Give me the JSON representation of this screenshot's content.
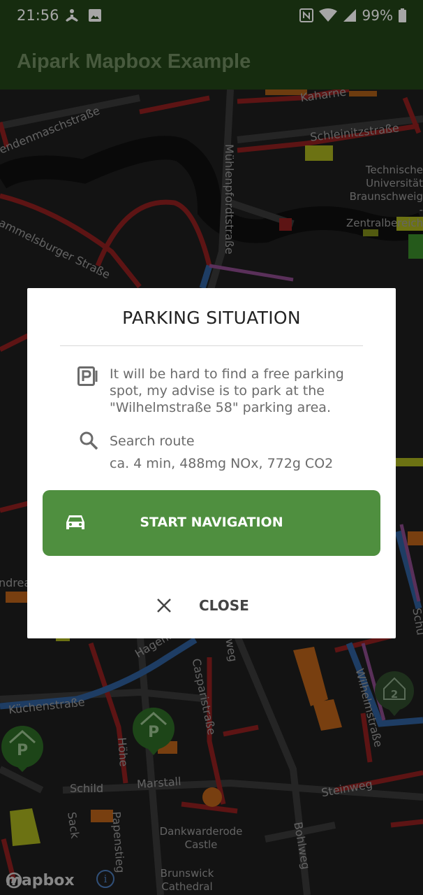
{
  "status_bar": {
    "time": "21:56",
    "battery": "99%",
    "icons": [
      "yoga-icon",
      "image-icon",
      "nfc-icon",
      "wifi-icon",
      "signal-icon",
      "battery-icon"
    ]
  },
  "app_bar": {
    "title": "Aipark Mapbox Example",
    "background": "#224418"
  },
  "map": {
    "labels": {
      "kahlrn": "Kaharne",
      "schleinitz": "Schleinitzstraße",
      "tu": "Technische Universität Braunschweig - Zentralbereich",
      "muehlenpford": "Mühlenpfordtstraße",
      "bammelsburger": "Bammelsburger Straße",
      "endenmasch": "endenmaschstraße",
      "andrea": "ndrea",
      "hagenbr": "Hagenbr",
      "kuechenstr": "Küchenstraße",
      "caspari": "Casparistraße",
      "hoehe": "Höhe",
      "marstall": "Marstall",
      "schild": "Schild",
      "sack": "Sack",
      "papenstieg": "Papenstieg",
      "dankwarderode": "Dankwarderode Castle",
      "brunswick": "Brunswick Cathedral",
      "bohlweg": "Bohlweg",
      "steinweg": "Steinweg",
      "wilhelmstr": "Wilhelmstraße",
      "schu": "Schu",
      "weg": "weg"
    },
    "markers": [
      "P",
      "P",
      "2"
    ],
    "attribution": "mapbox",
    "info": "i"
  },
  "dialog": {
    "title": "PARKING SITUATION",
    "advice": "It will be hard to find a free parking spot, my advise is to park at the \"Wilhelmstraße 58\" parking area.",
    "route_title": "Search route",
    "route_details": "ca. 4 min, 488mg NOx, 772g CO2",
    "start_navigation_label": "START NAVIGATION",
    "close_label": "CLOSE",
    "accent": "#4f8f3f"
  }
}
